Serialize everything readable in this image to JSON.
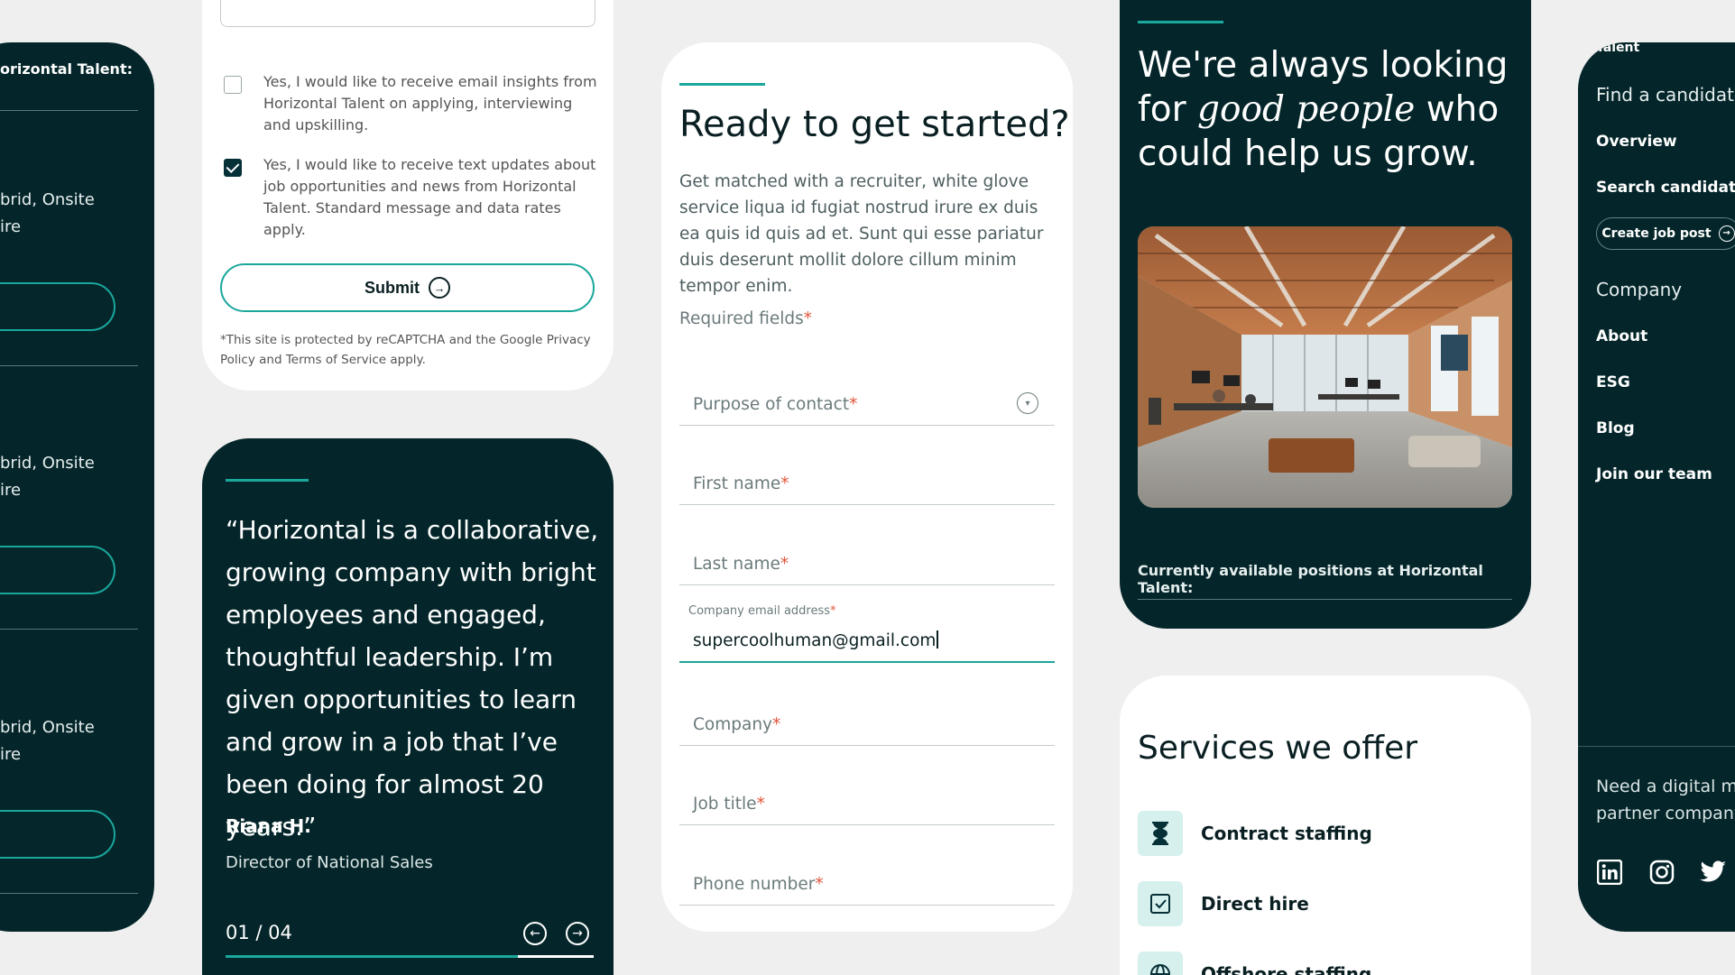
{
  "jobs_card": {
    "title": "orizontal Talent:",
    "jobs": [
      {
        "line1": "brid, Onsite",
        "line2": "ire"
      },
      {
        "line1": "brid, Onsite",
        "line2": "ire"
      },
      {
        "line1": "brid, Onsite",
        "line2": "ire"
      }
    ]
  },
  "form_bottom": {
    "email_opt_in": "Yes, I would like to receive email insights from Horizontal Talent on applying, interviewing and upskilling.",
    "email_opt_in_checked": false,
    "text_opt_in": "Yes, I would like to receive text updates about job opportunities and news from Horizontal Talent. Standard message and data rates apply.",
    "text_opt_in_checked": true,
    "submit_label": "Submit",
    "recaptcha_note": "*This site is protected by reCAPTCHA and the Google Privacy Policy and Terms of Service apply."
  },
  "testimonial": {
    "quote": "“Horizontal is a collaborative, growing company with bright employees and engaged, thoughtful leadership. I’m given opportunities to learn and grow in a job that I’ve been doing for almost 20 years.”",
    "name": "Riana H.",
    "role": "Director of National Sales",
    "pager": "01 / 04",
    "progress": 0.25
  },
  "contact_form": {
    "title": "Ready to get started?",
    "description": "Get matched with a recruiter, white glove service liqua id fugiat nostrud irure ex duis ea quis id quis ad et. Sunt qui esse pariatur duis deserunt mollit dolore cillum minim tempor enim.",
    "required_label": "Required fields",
    "fields": {
      "purpose": "Purpose of contact",
      "first_name": "First name",
      "last_name": "Last name",
      "email_label": "Company email address",
      "email_value": "supercoolhuman@gmail.com",
      "company": "Company",
      "job_title": "Job title",
      "phone": "Phone number"
    },
    "asterisk": "*"
  },
  "careers": {
    "title_before": "We're always looking for ",
    "title_em": "good people",
    "title_after": " who could help us grow.",
    "positions_label": "Currently available positions at Horizontal Talent:"
  },
  "services": {
    "title": "Services we offer",
    "items": [
      {
        "label": "Contract staffing",
        "icon": "hourglass-icon"
      },
      {
        "label": "Direct hire",
        "icon": "checkbox-icon"
      },
      {
        "label": "Offshore staffing",
        "icon": "globe-icon"
      }
    ]
  },
  "nav": {
    "top_label": "Talent",
    "find_candidate": "Find a candidate",
    "overview": "Overview",
    "search_candidates": "Search candidates",
    "create_job_post": "Create job post",
    "company": "Company",
    "about": "About",
    "esg": "ESG",
    "blog": "Blog",
    "join_team": "Join our team",
    "need_digital": "Need a digital ma partner company",
    "social": [
      "linkedin-icon",
      "instagram-icon",
      "twitter-icon"
    ]
  },
  "colors": {
    "dark_bg": "#04262a",
    "accent": "#1aa79c",
    "required": "#e0553b"
  }
}
